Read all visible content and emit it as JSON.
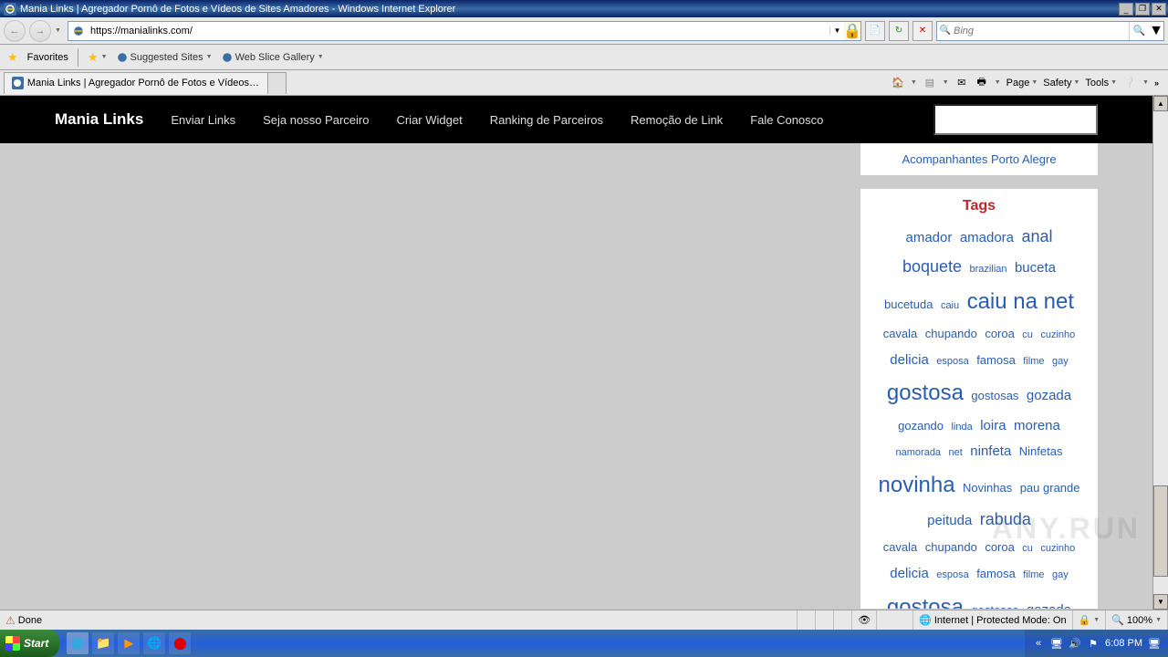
{
  "window": {
    "title": "Mania Links | Agregador Pornô de Fotos e Vídeos de Sites Amadores - Windows Internet Explorer"
  },
  "address": {
    "url": "https://manialinks.com/"
  },
  "search": {
    "placeholder": "Bing"
  },
  "favorites": {
    "label": "Favorites",
    "suggested": "Suggested Sites",
    "webslice": "Web Slice Gallery"
  },
  "tab": {
    "title": "Mania Links | Agregador Pornô de Fotos e Vídeos de S..."
  },
  "cmdbar": {
    "page": "Page",
    "safety": "Safety",
    "tools": "Tools"
  },
  "site": {
    "logo": "Mania Links",
    "nav": {
      "enviar": "Enviar Links",
      "parceiro": "Seja nosso Parceiro",
      "widget": "Criar Widget",
      "ranking": "Ranking de Parceiros",
      "remocao": "Remoção de Link",
      "contato": "Fale Conosco"
    }
  },
  "sidebar": {
    "link1": "Acompanhantes Porto Alegre",
    "tags_title": "Tags",
    "tags": {
      "amador": "amador",
      "amadora": "amadora",
      "anal": "anal",
      "boquete": "boquete",
      "brazilian": "brazilian",
      "buceta": "buceta",
      "bucetuda": "bucetuda",
      "caiu": "caiu",
      "caiunanet": "caiu na net",
      "cavala": "cavala",
      "chupando": "chupando",
      "coroa": "coroa",
      "cu": "cu",
      "cuzinho": "cuzinho",
      "delicia": "delicia",
      "esposa": "esposa",
      "famosa": "famosa",
      "filme": "filme",
      "gay": "gay",
      "gostosa": "gostosa",
      "gostosas": "gostosas",
      "gozada": "gozada",
      "gozando": "gozando",
      "linda": "linda",
      "loira": "loira",
      "morena": "morena",
      "namorada": "namorada",
      "net": "net",
      "ninfeta": "ninfeta",
      "ninfetas": "Ninfetas",
      "novinha": "novinha",
      "novinhas": "Novinhas",
      "paugrande": "pau grande",
      "peituda": "peituda",
      "rabuda": "rabuda"
    }
  },
  "status": {
    "done": "Done",
    "zone": "Internet | Protected Mode: On",
    "zoom": "100%"
  },
  "taskbar": {
    "start": "Start",
    "clock": "6:08 PM"
  },
  "watermark": "ANY.RUN"
}
